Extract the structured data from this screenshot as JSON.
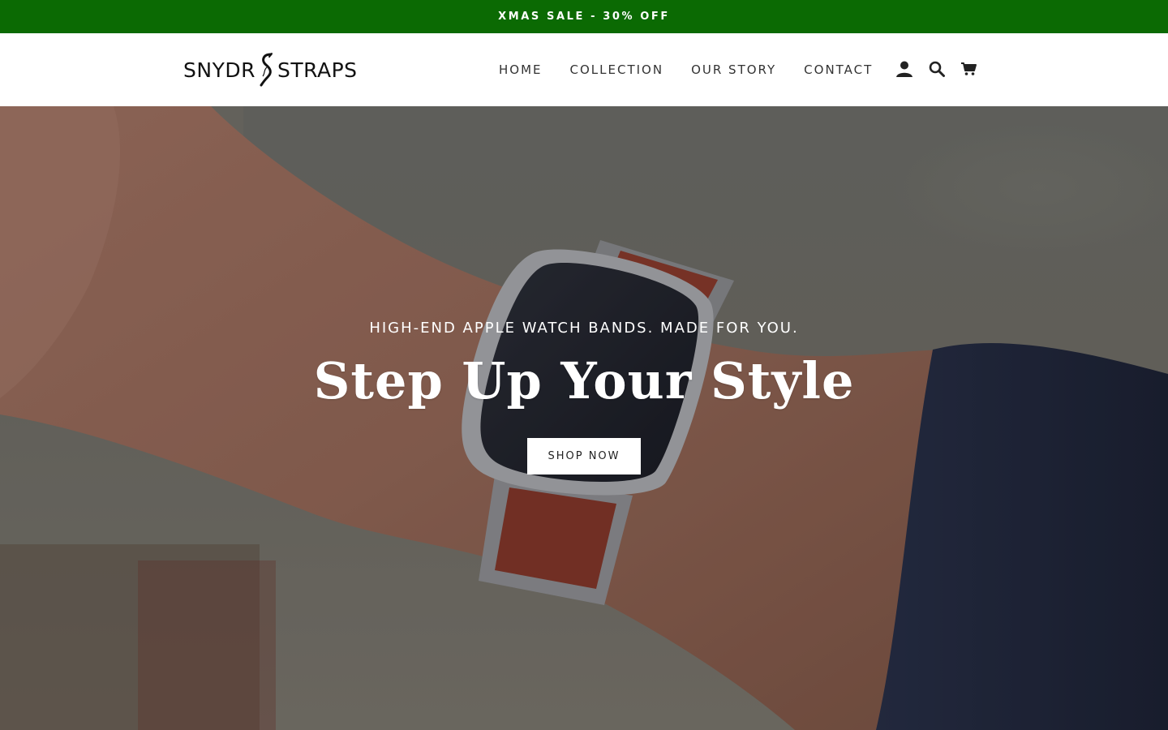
{
  "announcement": {
    "text": "XMAS SALE - 30% OFF"
  },
  "header": {
    "logo_left": "SNYDR",
    "logo_right": "STRAPS",
    "nav": [
      {
        "label": "HOME"
      },
      {
        "label": "COLLECTION"
      },
      {
        "label": "OUR STORY"
      },
      {
        "label": "CONTACT"
      }
    ],
    "icons": [
      "account-icon",
      "search-icon",
      "cart-icon"
    ]
  },
  "hero": {
    "subtitle": "HIGH-END APPLE WATCH BANDS. MADE FOR YOU.",
    "title": "Step Up Your Style",
    "button_label": "SHOP NOW"
  },
  "colors": {
    "announcement_bg": "#0b6a03",
    "header_bg": "#ffffff",
    "text_dark": "#222222"
  }
}
